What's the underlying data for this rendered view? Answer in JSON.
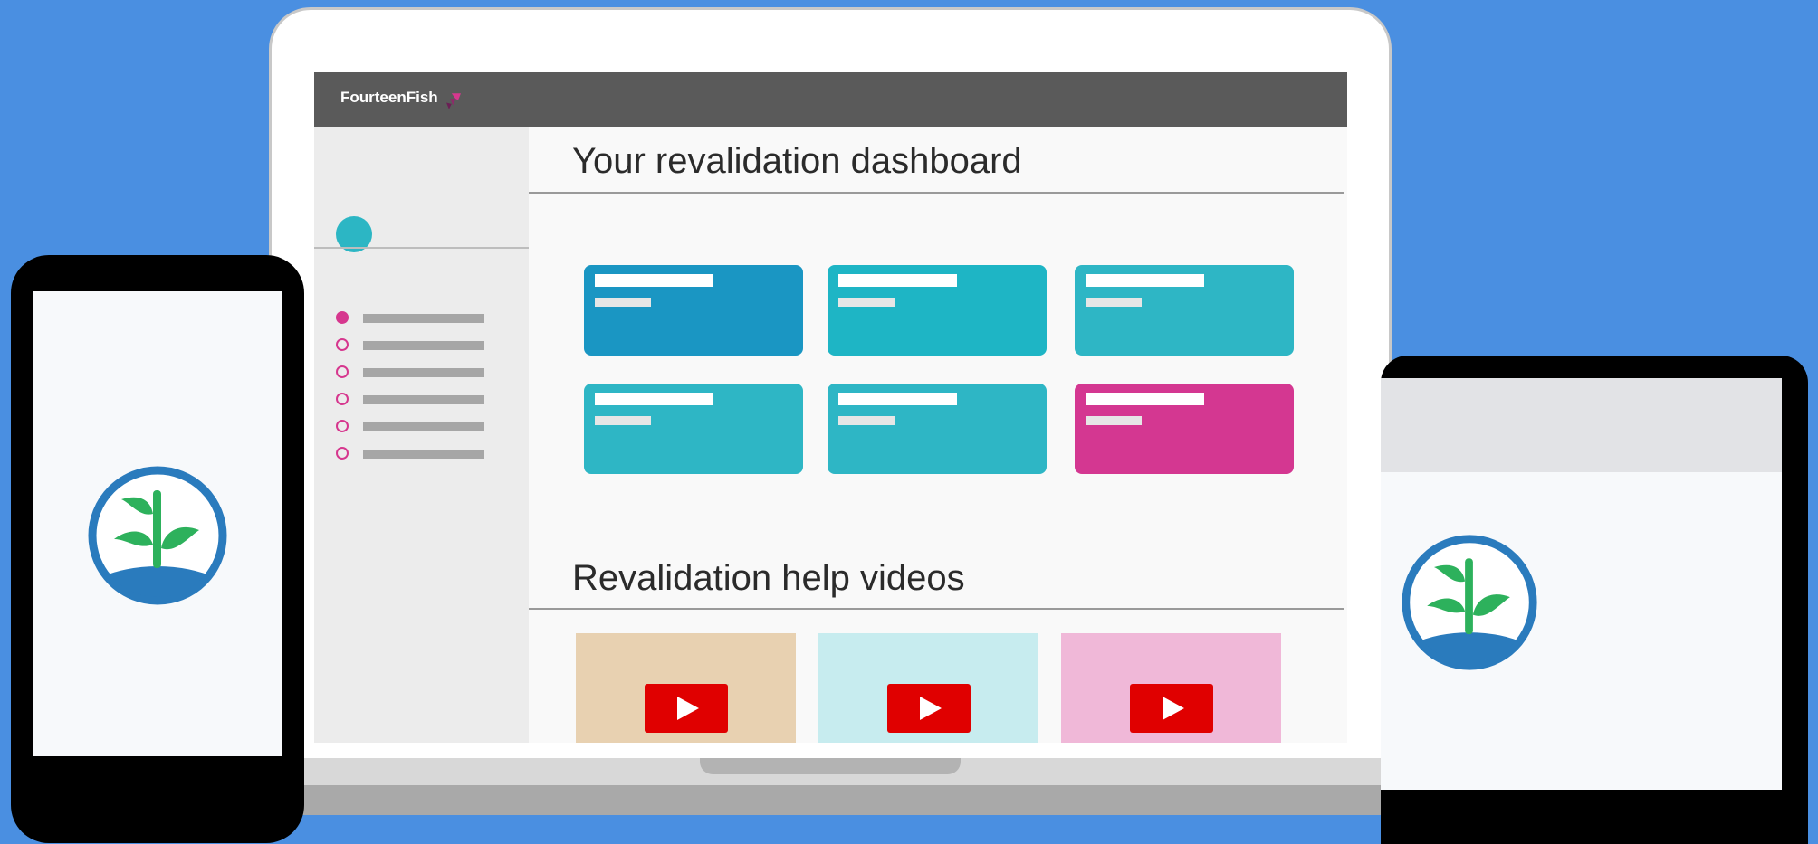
{
  "app": {
    "brand": "FourteenFish"
  },
  "dashboard": {
    "title": "Your revalidation dashboard",
    "nav_count": 6,
    "tiles": [
      {
        "color": "#1a96c3"
      },
      {
        "color": "#1eb5c5"
      },
      {
        "color": "#2eb6c5"
      },
      {
        "color": "#2eb6c5"
      },
      {
        "color": "#2eb6c5"
      },
      {
        "color": "#d43791"
      }
    ]
  },
  "videos": {
    "title": "Revalidation help videos",
    "thumbnails": [
      {
        "color": "#e8d1b1"
      },
      {
        "color": "#c7ecef"
      },
      {
        "color": "#f0b8d8"
      }
    ]
  },
  "icons": {
    "play": "play-icon",
    "logo": "plant-logo-icon"
  },
  "colors": {
    "background": "#4a8fe1",
    "accent_pink": "#d6378e",
    "accent_teal": "#2cb6c4",
    "play_red": "#e00000"
  }
}
